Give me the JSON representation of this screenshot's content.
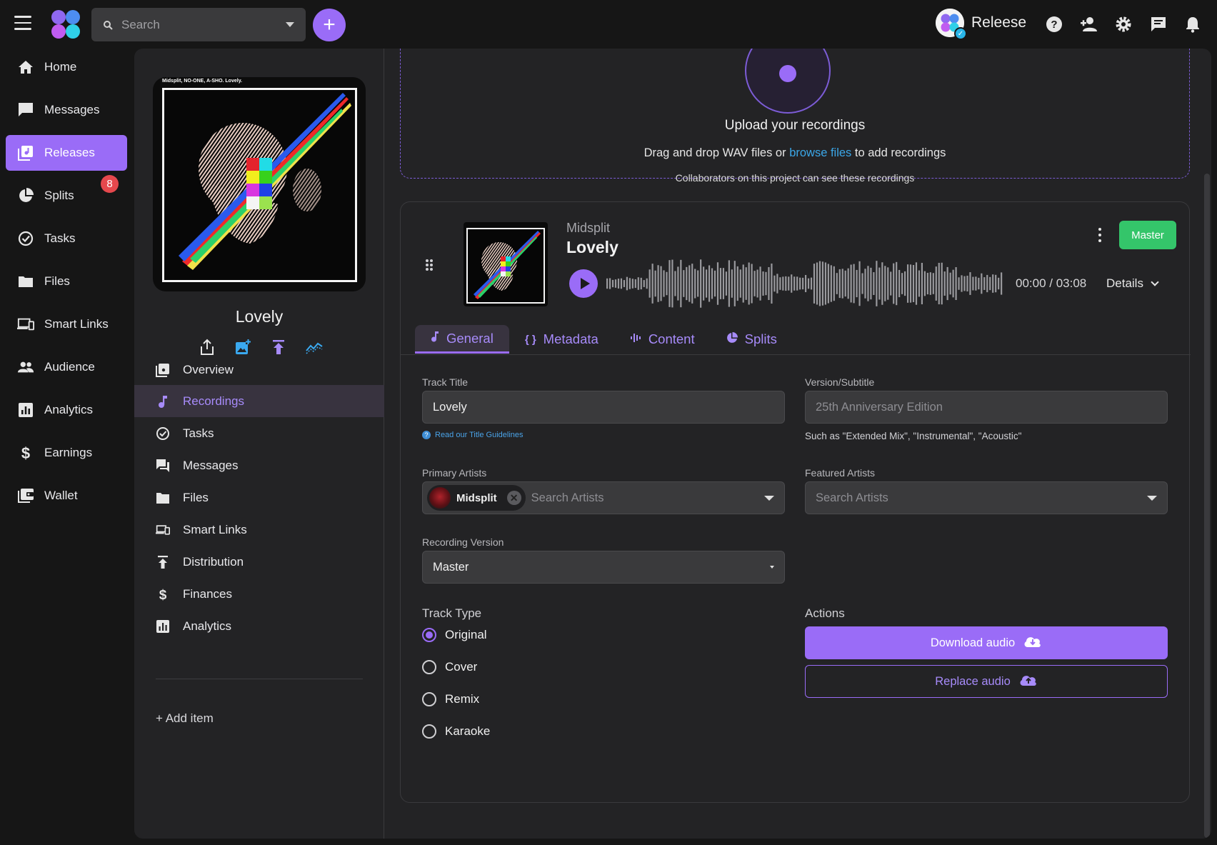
{
  "topbar": {
    "search_placeholder": "Search",
    "brand_name": "Releese",
    "icons": [
      "help-icon",
      "add-user-icon",
      "gear-icon",
      "chat-icon",
      "bell-icon"
    ]
  },
  "sidebar": {
    "items": [
      {
        "label": "Home",
        "icon": "home-icon"
      },
      {
        "label": "Messages",
        "icon": "chat-bubble-icon"
      },
      {
        "label": "Releases",
        "icon": "releases-icon",
        "active": true
      },
      {
        "label": "Splits",
        "icon": "pie-icon",
        "badge": "8"
      },
      {
        "label": "Tasks",
        "icon": "check-circle-icon"
      },
      {
        "label": "Files",
        "icon": "folder-icon"
      },
      {
        "label": "Smart Links",
        "icon": "devices-icon"
      },
      {
        "label": "Audience",
        "icon": "people-icon"
      },
      {
        "label": "Analytics",
        "icon": "bar-chart-icon"
      },
      {
        "label": "Earnings",
        "icon": "dollar-icon"
      },
      {
        "label": "Wallet",
        "icon": "wallet-icon"
      }
    ]
  },
  "release": {
    "cover_text": "Midsplit, NO-ONE, A-SHO. Lovely.",
    "name": "Lovely",
    "subnav": [
      {
        "label": "Overview"
      },
      {
        "label": "Recordings",
        "active": true
      },
      {
        "label": "Tasks"
      },
      {
        "label": "Messages"
      },
      {
        "label": "Files"
      },
      {
        "label": "Smart Links"
      },
      {
        "label": "Distribution"
      },
      {
        "label": "Finances"
      },
      {
        "label": "Analytics"
      }
    ],
    "add_item": "+ Add item"
  },
  "upload": {
    "title": "Upload your recordings",
    "line_before": "Drag and drop WAV files or ",
    "link": "browse files",
    "line_after": " to add recordings",
    "note": "Collaborators on this project can see these recordings"
  },
  "track": {
    "artist": "Midsplit",
    "title": "Lovely",
    "version_badge": "Master",
    "time": "00:00 / 03:08",
    "details": "Details",
    "progress_fraction": 0,
    "tabs": [
      "General",
      "Metadata",
      "Content",
      "Splits"
    ],
    "active_tab": "General",
    "form": {
      "track_title_label": "Track Title",
      "track_title_value": "Lovely",
      "guidelines_link": "Read our Title Guidelines",
      "version_label": "Version/Subtitle",
      "version_placeholder": "25th Anniversary Edition",
      "version_hint": "Such as \"Extended Mix\", \"Instrumental\", \"Acoustic\"",
      "primary_artists_label": "Primary Artists",
      "primary_artist_chip": "Midsplit",
      "primary_artists_placeholder": "Search Artists",
      "featured_artists_label": "Featured Artists",
      "featured_artists_placeholder": "Search Artists",
      "recording_version_label": "Recording Version",
      "recording_version_value": "Master",
      "track_type_label": "Track Type",
      "track_types": [
        "Original",
        "Cover",
        "Remix",
        "Karaoke"
      ],
      "track_type_selected": "Original",
      "actions_label": "Actions",
      "download_label": "Download audio",
      "replace_label": "Replace audio"
    }
  },
  "colors": {
    "accent": "#9a6cf7",
    "master_badge": "#34c56a",
    "notification_badge": "#e5484d",
    "link": "#3ba7e8"
  }
}
